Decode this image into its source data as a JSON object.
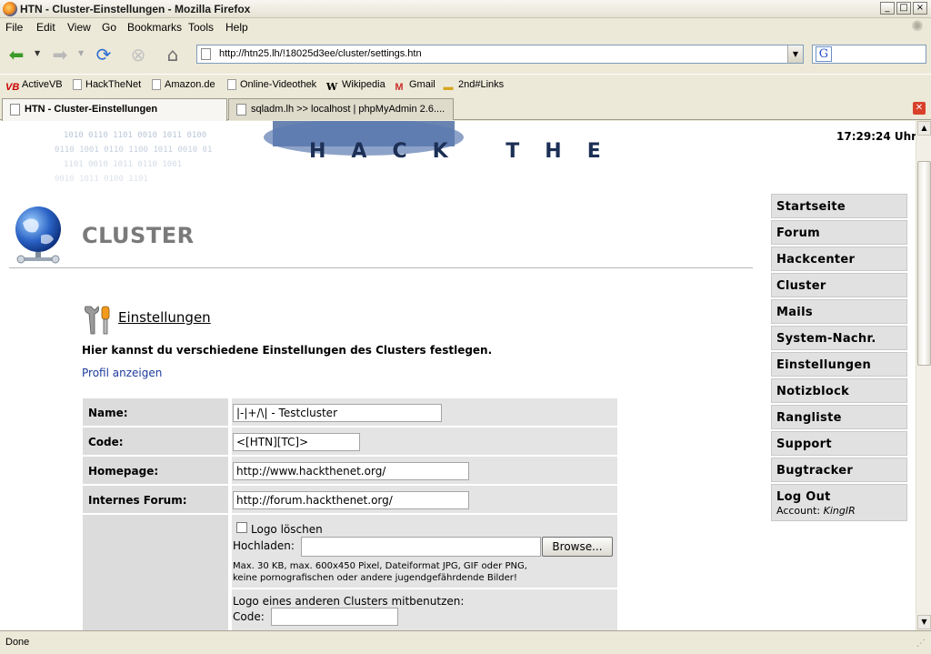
{
  "window": {
    "title": "HTN - Cluster-Einstellungen - Mozilla Firefox",
    "controls": [
      "_",
      "□",
      "×"
    ]
  },
  "menu": [
    "File",
    "Edit",
    "View",
    "Go",
    "Bookmarks",
    "Tools",
    "Help"
  ],
  "nav": {
    "url": "http://htn25.lh/!18025d3ee/cluster/settings.htn",
    "search_engine_glyph": "G"
  },
  "bookmarks": [
    {
      "label": "ActiveVB",
      "icon": "activevb-icon"
    },
    {
      "label": "HackTheNet",
      "icon": "page-icon"
    },
    {
      "label": "Amazon.de",
      "icon": "page-icon"
    },
    {
      "label": "Online-Videothek",
      "icon": "page-icon"
    },
    {
      "label": "Wikipedia",
      "icon": "wikipedia-icon"
    },
    {
      "label": "Gmail",
      "icon": "gmail-icon"
    },
    {
      "label": "2nd#Links",
      "icon": "folder-icon"
    }
  ],
  "tabs": [
    {
      "label": "HTN - Cluster-Einstellungen",
      "active": true
    },
    {
      "label": "sqladm.lh >> localhost | phpMyAdmin 2.6....",
      "active": false
    }
  ],
  "page": {
    "clock": "17:29:24 Uhr",
    "title": "CLUSTER",
    "section_title": "Einstellungen",
    "intro": "Hier kannst du verschiedene Einstellungen des Clusters festlegen.",
    "profile_link": "Profil anzeigen",
    "banner_text": "HACK THE NET",
    "form": {
      "name_label": "Name:",
      "name_value": "|-|+/\\| - Testcluster",
      "code_label": "Code:",
      "code_value": "<[HTN][TC]>",
      "homepage_label": "Homepage:",
      "homepage_value": "http://www.hackthenet.org/",
      "forum_label": "Internes Forum:",
      "forum_value": "http://forum.hackthenet.org/",
      "logo_delete_label": "Logo löschen",
      "upload_label": "Hochladen:",
      "browse_label": "Browse...",
      "upload_hint_1": "Max. 30 KB, max. 600x450 Pixel, Dateiformat JPG, GIF oder PNG,",
      "upload_hint_2": "keine pornografischen oder andere jugendgefährdende Bilder!",
      "shared_logo_label": "Logo eines anderen Clusters mitbenutzen:",
      "shared_code_label": "Code:"
    }
  },
  "sidenav": {
    "items": [
      "Startseite",
      "Forum",
      "Hackcenter",
      "Cluster",
      "Mails",
      "System-Nachr.",
      "Einstellungen",
      "Notizblock",
      "Rangliste",
      "Support",
      "Bugtracker"
    ],
    "logout": "Log Out",
    "account_prefix": "Account:",
    "account_name": "KingIR"
  },
  "status": "Done",
  "colors": {
    "link": "#1d3b9a",
    "title_gray": "#7a7a7a",
    "nav_bg": "#e1e1e1"
  }
}
